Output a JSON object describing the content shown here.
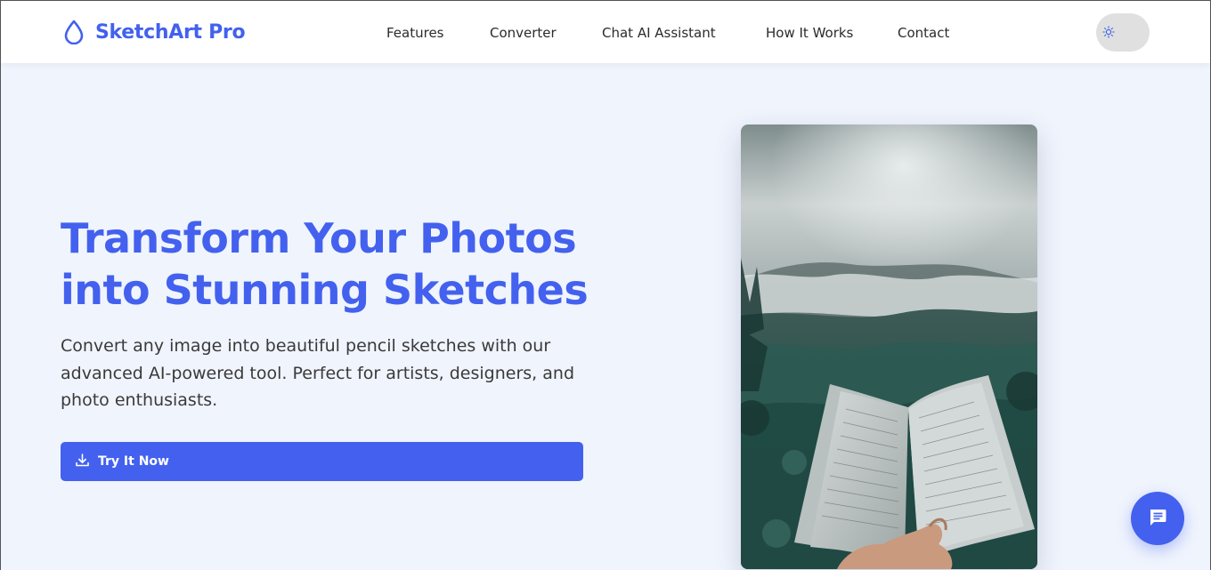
{
  "brand": {
    "name": "SketchArt Pro",
    "icon": "droplet-icon",
    "accent_color": "#4361ee"
  },
  "nav": {
    "items": [
      {
        "label": "Features"
      },
      {
        "label": "Converter"
      },
      {
        "label": "Chat AI Assistant"
      },
      {
        "label": "How It Works"
      },
      {
        "label": "Contact"
      }
    ]
  },
  "theme_toggle": {
    "icon": "sun-icon",
    "track_color": "#e0e0e0"
  },
  "hero": {
    "title_line1": "Transform Your Photos",
    "title_line2": "into Stunning Sketches",
    "description": "Convert any image into beautiful pencil sketches with our advanced AI-powered tool. Perfect for artists, designers, and photo enthusiasts.",
    "cta": {
      "label": "Try It Now",
      "icon": "download-icon"
    },
    "image_subject": "open-book-forest-photo"
  },
  "chat_fab": {
    "icon": "chat-bubble-icon",
    "color": "#4361ee"
  },
  "colors": {
    "page_background": "#f0f4fd",
    "header_background": "#ffffff",
    "text_dark": "#2b2b2b"
  }
}
